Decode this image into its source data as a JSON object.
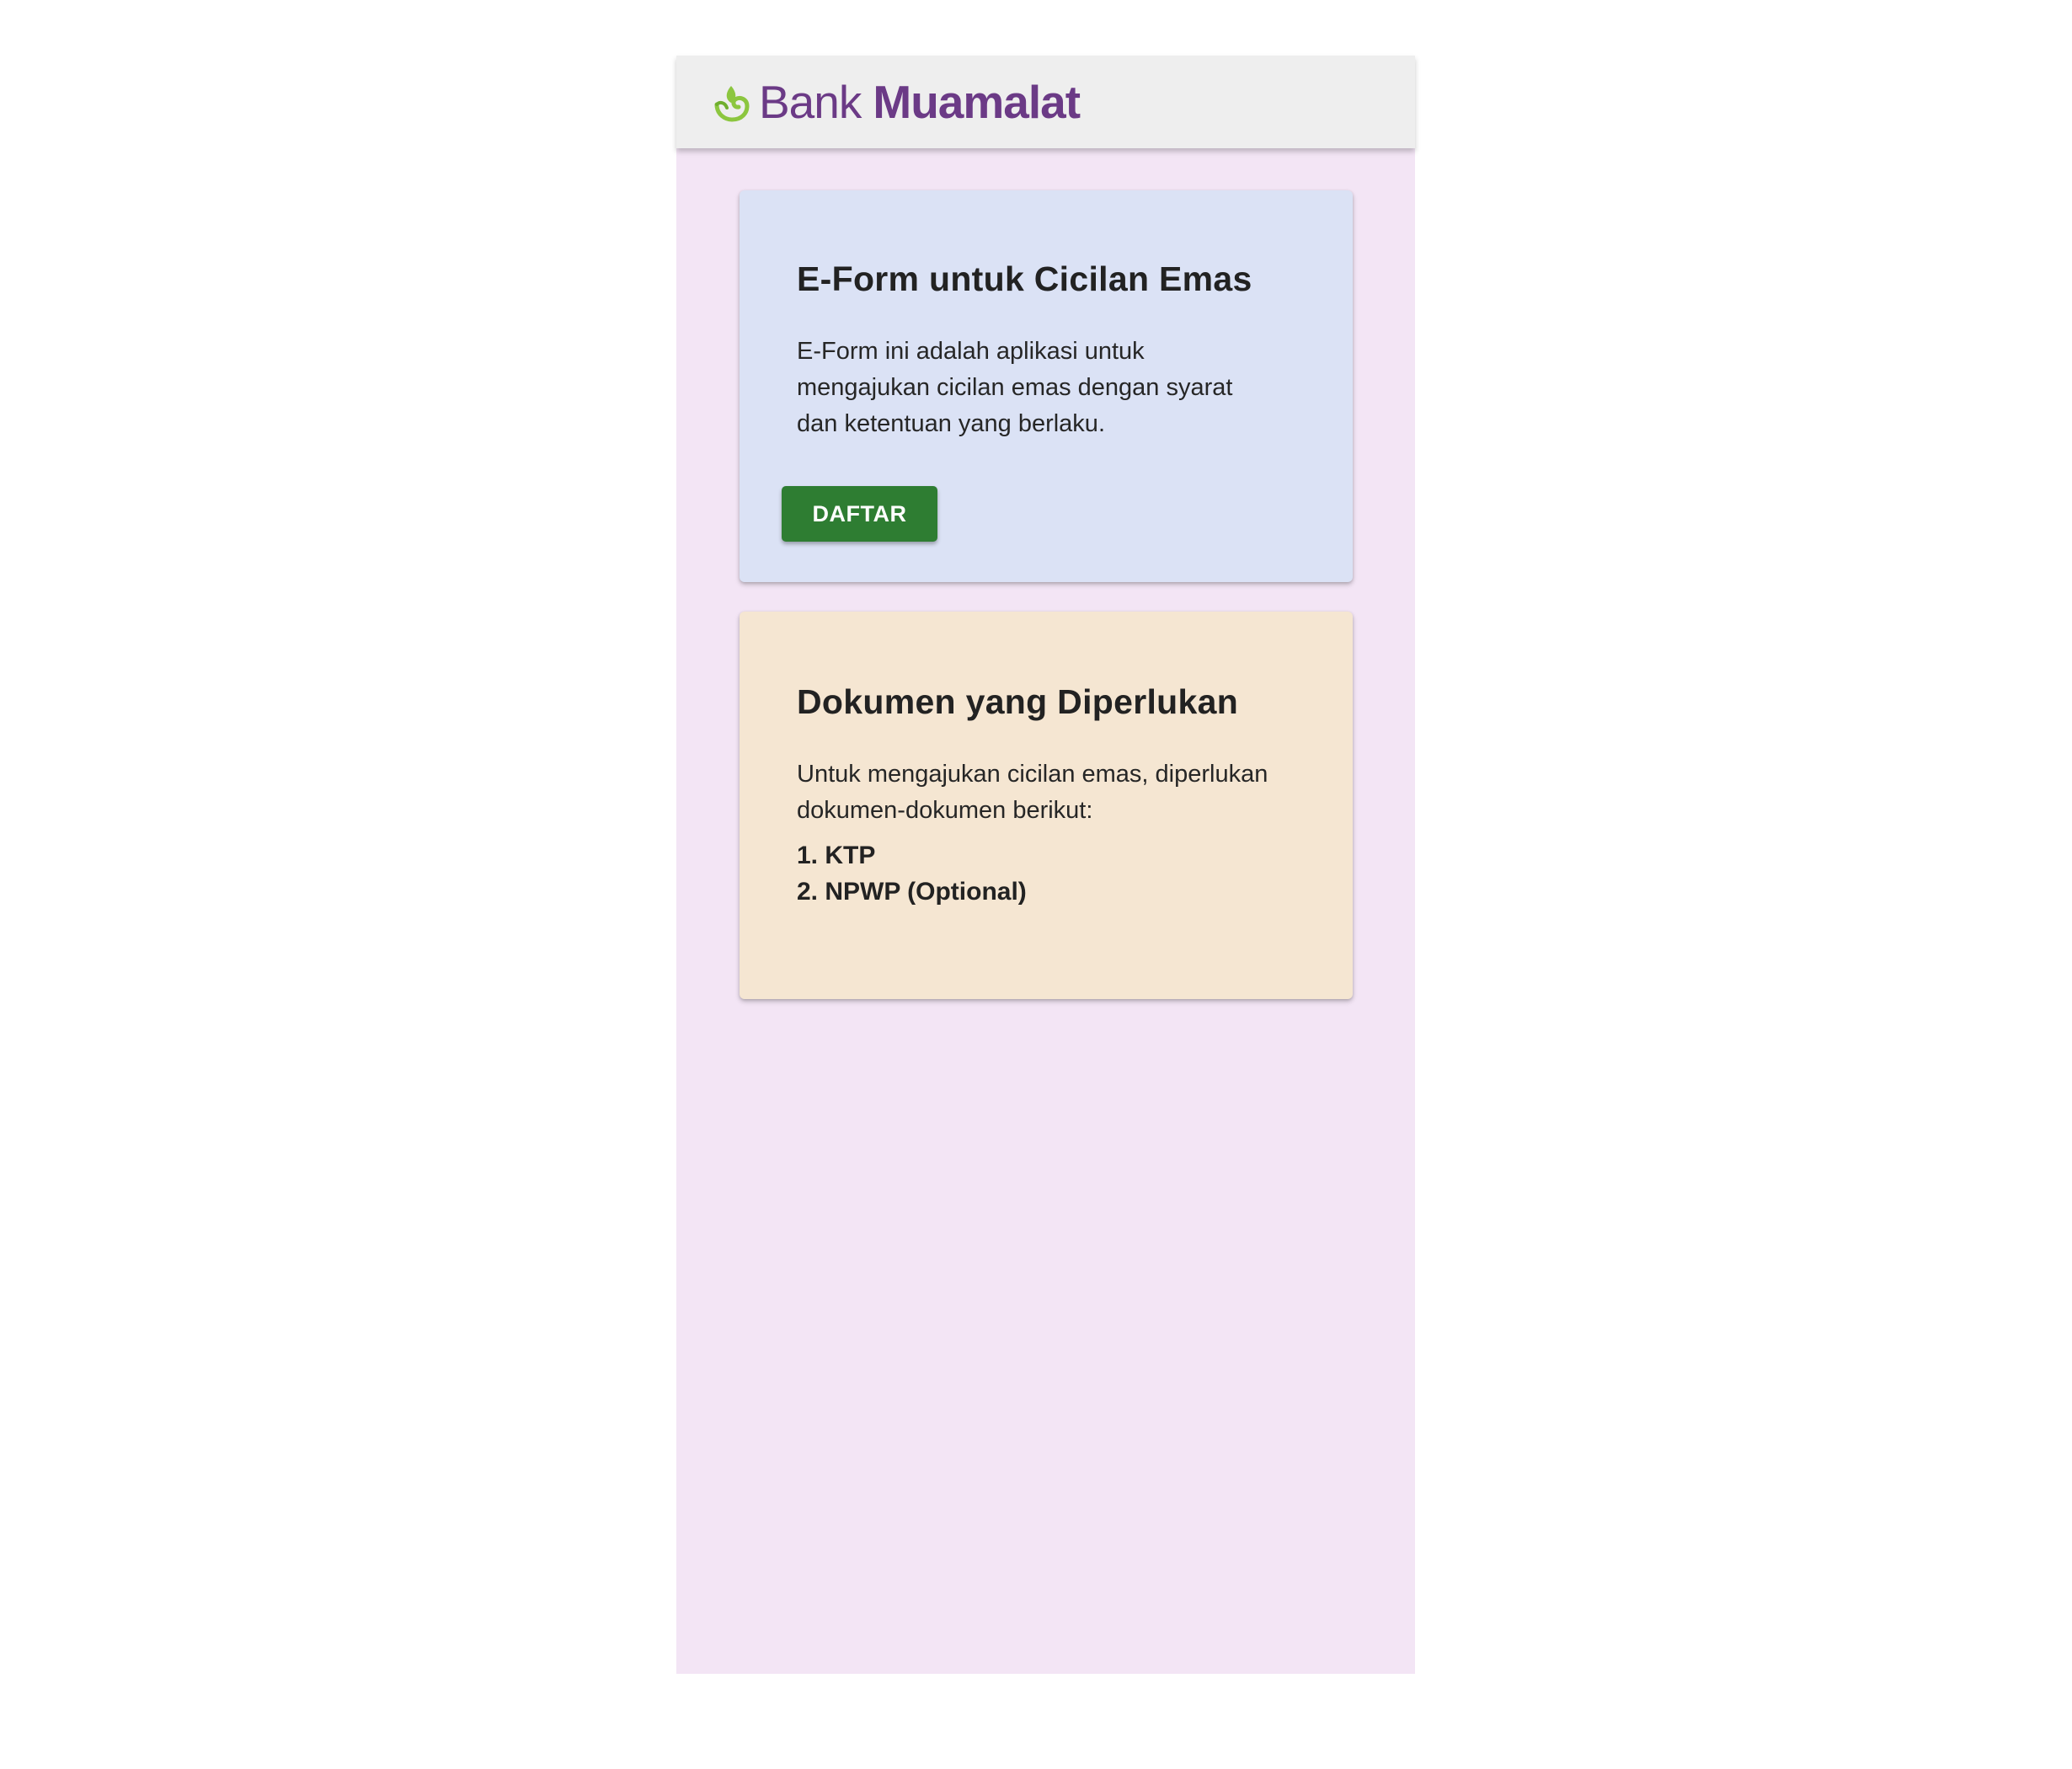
{
  "header": {
    "brand_bank": "Bank",
    "brand_name": "Muamalat",
    "brand_color": "#6b3a86",
    "logo_icon": "muamalat-leaf-icon",
    "icon_color": "#7cc24a"
  },
  "eform_card": {
    "title": "E-Form untuk Cicilan Emas",
    "description": "E-Form ini adalah aplikasi untuk mengajukan cicilan emas dengan syarat dan ketentuan yang berlaku.",
    "button_label": "DAFTAR",
    "background": "#dbe2f5",
    "button_color": "#2e7d32"
  },
  "docs_card": {
    "title": "Dokumen yang Diperlukan",
    "description": "Untuk mengajukan cicilan emas, diperlukan dokumen-dokumen berikut:",
    "items": [
      "1. KTP",
      "2. NPWP (Optional)"
    ],
    "background": "#f5e6d2"
  },
  "page_background": "#f3e5f5"
}
